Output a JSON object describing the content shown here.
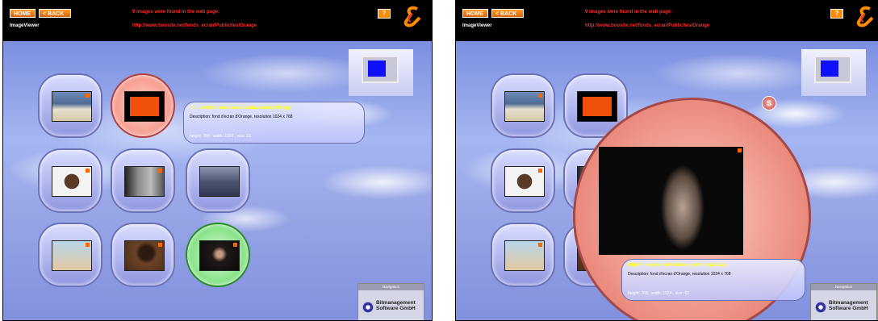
{
  "colors": {
    "accent": "#ff8a00",
    "message": "#ff2a2a",
    "url": "#ffff20"
  },
  "panels": [
    {
      "home": "HOME",
      "back": "< BACK",
      "title": "ImageViewer",
      "message": "9 images were found in the web page:",
      "page_url": "http://www.boosite.net/fonds_ecran/Publicites/Orange",
      "help": "?",
      "info": {
        "url": "http://r-ptxp-smartweb/orange/orange08.jpg",
        "description": "Description: fond d'ecran d'Orange, resolution 1024 x 768",
        "dims": "height: 768 , width: 1024 , size: 13"
      },
      "navigation": "Navigation",
      "brand": "Bitmanagement Software GmbH"
    },
    {
      "home": "HOME",
      "back": "< BACK",
      "title": "ImageViewer",
      "message": "9 images were found in the web page:",
      "page_url": "http://www.boosite.net/fonds_ecran/Publicites/Orange",
      "help": "?",
      "info": {
        "url": "http://r-ptxp-smartweb/orange/orange03.jpg",
        "description": "Description: fond d'ecran d'Orange, resolution 1024 x 768",
        "dims": "height: 768 , width: 1024 , size: 62"
      },
      "navigation": "Navigation",
      "brand": "Bitmanagement Software GmbH",
      "close": "S"
    }
  ]
}
